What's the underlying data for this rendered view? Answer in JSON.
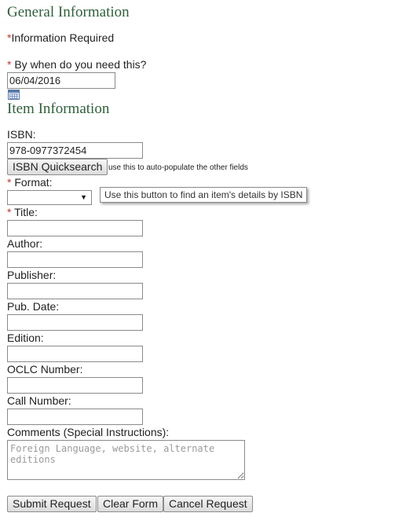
{
  "general": {
    "heading": "General Information",
    "required_marker": "*",
    "required_note": "Information Required",
    "need_by_label": " By when do you need this?",
    "need_by_value": "06/04/2016"
  },
  "item": {
    "heading": "Item Information",
    "isbn_label": "ISBN:",
    "isbn_value": "978-0977372454",
    "quicksearch_label": "ISBN Quicksearch",
    "quicksearch_hint": "use this to auto-populate the other fields",
    "tooltip": "Use this button to find an item's details by ISBN",
    "format_label": " Format:",
    "format_value": "",
    "title_label": " Title:",
    "author_label": "Author:",
    "publisher_label": "Publisher:",
    "pubdate_label": "Pub. Date:",
    "edition_label": "Edition:",
    "oclc_label": "OCLC Number:",
    "callnumber_label": "Call Number:",
    "comments_label": "Comments (Special Instructions):",
    "comments_placeholder": "Foreign Language, website, alternate editions"
  },
  "actions": {
    "submit": "Submit Request",
    "clear": "Clear Form",
    "cancel": "Cancel Request"
  },
  "icons": {
    "calendar": "calendar-icon",
    "dropdown": "chevron-down-icon"
  },
  "colors": {
    "heading": "#2f5f3a",
    "required": "#c0392b"
  }
}
